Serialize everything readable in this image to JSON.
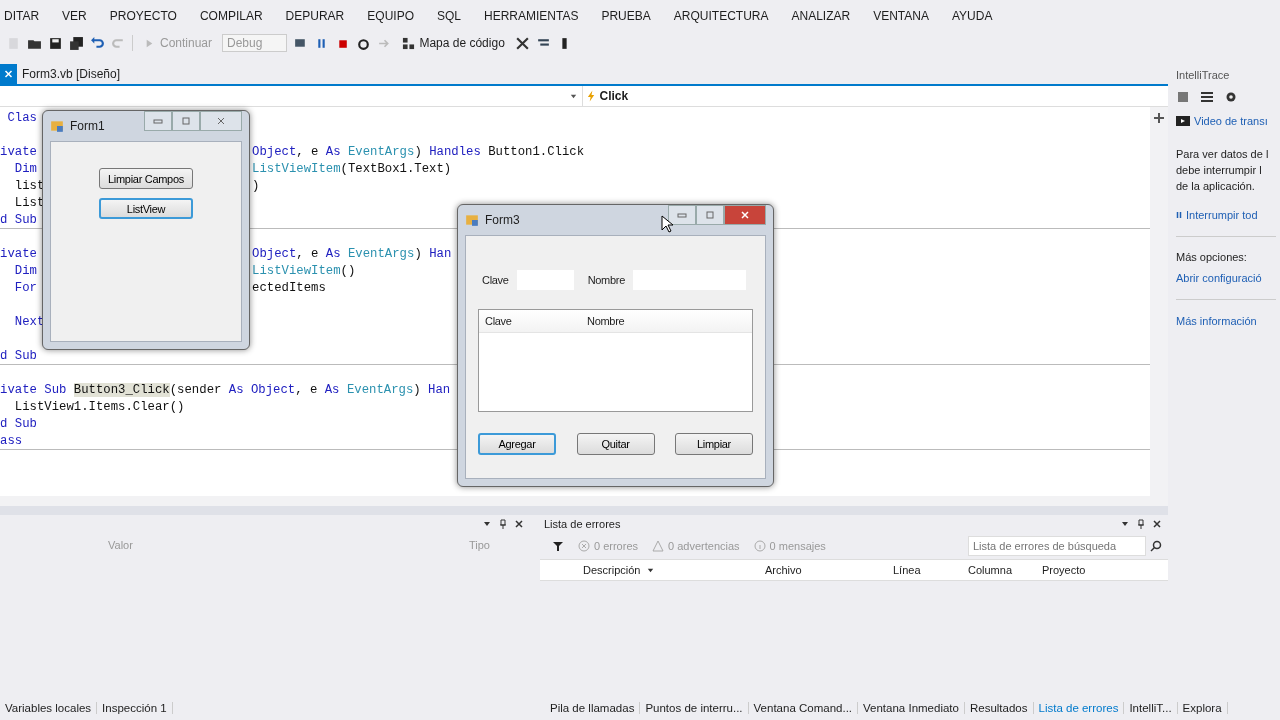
{
  "menu": [
    "DITAR",
    "VER",
    "PROYECTO",
    "COMPILAR",
    "DEPURAR",
    "EQUIPO",
    "SQL",
    "HERRAMIENTAS",
    "PRUEBA",
    "ARQUITECTURA",
    "ANALIZAR",
    "VENTANA",
    "AYUDA"
  ],
  "toolbar": {
    "continue": "Continuar",
    "configuration": "Debug",
    "code_map": "Mapa de código"
  },
  "doc_tabs": [
    {
      "label": "Form3.vb [Diseño]",
      "selected": true
    }
  ],
  "editor": {
    "member": "Click",
    "lines": [
      {
        "kind": "code",
        "left": [
          {
            "text": " Clas",
            "kind": "kw"
          }
        ]
      },
      {
        "kind": "blank"
      },
      {
        "kind": "code",
        "left": [
          {
            "text": "ivate",
            "kind": "kw"
          }
        ],
        "right": [
          {
            "text": "Object",
            "kind": "kw"
          },
          {
            "text": ", e ",
            "kind": "plain"
          },
          {
            "text": "As",
            "kind": "kw"
          },
          {
            "text": " EventArgs",
            "kind": "type"
          },
          {
            "text": ") ",
            "kind": "plain"
          },
          {
            "text": "Handles",
            "kind": "kw"
          },
          {
            "text": " Button1.Click",
            "kind": "plain"
          }
        ]
      },
      {
        "kind": "code",
        "left": [
          {
            "text": "  Dim",
            "kind": "kw"
          }
        ],
        "right": [
          {
            "text": "ListViewItem",
            "kind": "type"
          },
          {
            "text": "(TextBox1.Text)",
            "kind": "plain"
          }
        ]
      },
      {
        "kind": "code",
        "left": [
          {
            "text": "  list",
            "kind": "plain"
          }
        ],
        "right": [
          {
            "text": ")",
            "kind": "plain"
          }
        ]
      },
      {
        "kind": "code",
        "left": [
          {
            "text": "  List",
            "kind": "plain"
          }
        ]
      },
      {
        "kind": "code",
        "left": [
          {
            "text": "d Sub",
            "kind": "kw"
          }
        ]
      },
      {
        "kind": "separator"
      },
      {
        "kind": "blank"
      },
      {
        "kind": "code",
        "left": [
          {
            "text": "ivate",
            "kind": "kw"
          }
        ],
        "right": [
          {
            "text": "Object",
            "kind": "kw"
          },
          {
            "text": ", e ",
            "kind": "plain"
          },
          {
            "text": "As",
            "kind": "kw"
          },
          {
            "text": " EventArgs",
            "kind": "type"
          },
          {
            "text": ") ",
            "kind": "plain"
          },
          {
            "text": "Han",
            "kind": "kw"
          }
        ]
      },
      {
        "kind": "code",
        "left": [
          {
            "text": "  Dim",
            "kind": "kw"
          }
        ],
        "right": [
          {
            "text": "ListViewItem",
            "kind": "type"
          },
          {
            "text": "()",
            "kind": "plain"
          }
        ]
      },
      {
        "kind": "code",
        "left": [
          {
            "text": "  For",
            "kind": "kw"
          }
        ],
        "right": [
          {
            "text": "ectedItems",
            "kind": "plain"
          }
        ]
      },
      {
        "kind": "blank"
      },
      {
        "kind": "code",
        "left": [
          {
            "text": "  Next",
            "kind": "kw"
          }
        ]
      },
      {
        "kind": "blank"
      },
      {
        "kind": "code",
        "left": [
          {
            "text": "d Sub",
            "kind": "kw"
          }
        ]
      },
      {
        "kind": "separator"
      },
      {
        "kind": "blank"
      },
      {
        "kind": "code",
        "left": [
          {
            "text": "ivate Sub ",
            "kind": "kw"
          },
          {
            "text": "Button3_Click",
            "kind": "hl"
          },
          {
            "text": "(sender ",
            "kind": "plain"
          },
          {
            "text": "As Object",
            "kind": "kw"
          },
          {
            "text": ", e ",
            "kind": "plain"
          },
          {
            "text": "As",
            "kind": "kw"
          },
          {
            "text": " EventArgs",
            "kind": "type"
          },
          {
            "text": ") ",
            "kind": "plain"
          },
          {
            "text": "Han",
            "kind": "kw"
          }
        ]
      },
      {
        "kind": "code",
        "left": [
          {
            "text": "  ListView1.Items.Clear()",
            "kind": "plain"
          }
        ]
      },
      {
        "kind": "code",
        "left": [
          {
            "text": "d Sub",
            "kind": "kw"
          }
        ]
      },
      {
        "kind": "code",
        "left": [
          {
            "text": "ass",
            "kind": "kw"
          }
        ]
      },
      {
        "kind": "separator"
      }
    ]
  },
  "form1": {
    "title": "Form1",
    "buttons": [
      {
        "label": "Limpiar Campos",
        "focused": false
      },
      {
        "label": "ListView",
        "focused": true
      }
    ]
  },
  "form3": {
    "title": "Form3",
    "fields": [
      {
        "label": "Clave"
      },
      {
        "label": "Nombre"
      }
    ],
    "list_columns": [
      "Clave",
      "Nombre"
    ],
    "buttons": [
      {
        "label": "Agregar",
        "focused": true
      },
      {
        "label": "Quitar",
        "focused": false
      },
      {
        "label": "Limpiar",
        "focused": false
      }
    ]
  },
  "locals": {
    "columns": [
      "Valor",
      "Tipo"
    ]
  },
  "errors": {
    "title": "Lista de errores",
    "counts": [
      {
        "kind": "error",
        "label": "0 errores"
      },
      {
        "kind": "warning",
        "label": "0 advertencias"
      },
      {
        "kind": "message",
        "label": "0 mensajes"
      }
    ],
    "search": {
      "placeholder": "Lista de errores de búsqueda"
    },
    "columns": [
      "Descripción",
      "Archivo",
      "Línea",
      "Columna",
      "Proyecto"
    ]
  },
  "intellitrace": {
    "title": "IntelliTrace",
    "video_link": "Video de transı",
    "message_lines": [
      "Para ver datos de l",
      "debe interrumpir l",
      "de la aplicación."
    ],
    "break_link": "Interrumpir tod",
    "more_label": "Más opciones:",
    "settings_link": "Abrir configuració",
    "info_link": "Más información"
  },
  "bottom_tabs_left": [
    {
      "label": "Variables locales",
      "selected": false
    },
    {
      "label": "Inspección 1",
      "selected": false
    }
  ],
  "bottom_tabs_right": [
    {
      "label": "Pila de llamadas",
      "selected": false
    },
    {
      "label": "Puntos de interru...",
      "selected": false
    },
    {
      "label": "Ventana Comand...",
      "selected": false
    },
    {
      "label": "Ventana Inmediato",
      "selected": false
    },
    {
      "label": "Resultados",
      "selected": false
    },
    {
      "label": "Lista de errores",
      "selected": true
    },
    {
      "label": "IntelliT...",
      "selected": false
    },
    {
      "label": "Explora",
      "selected": false
    }
  ]
}
